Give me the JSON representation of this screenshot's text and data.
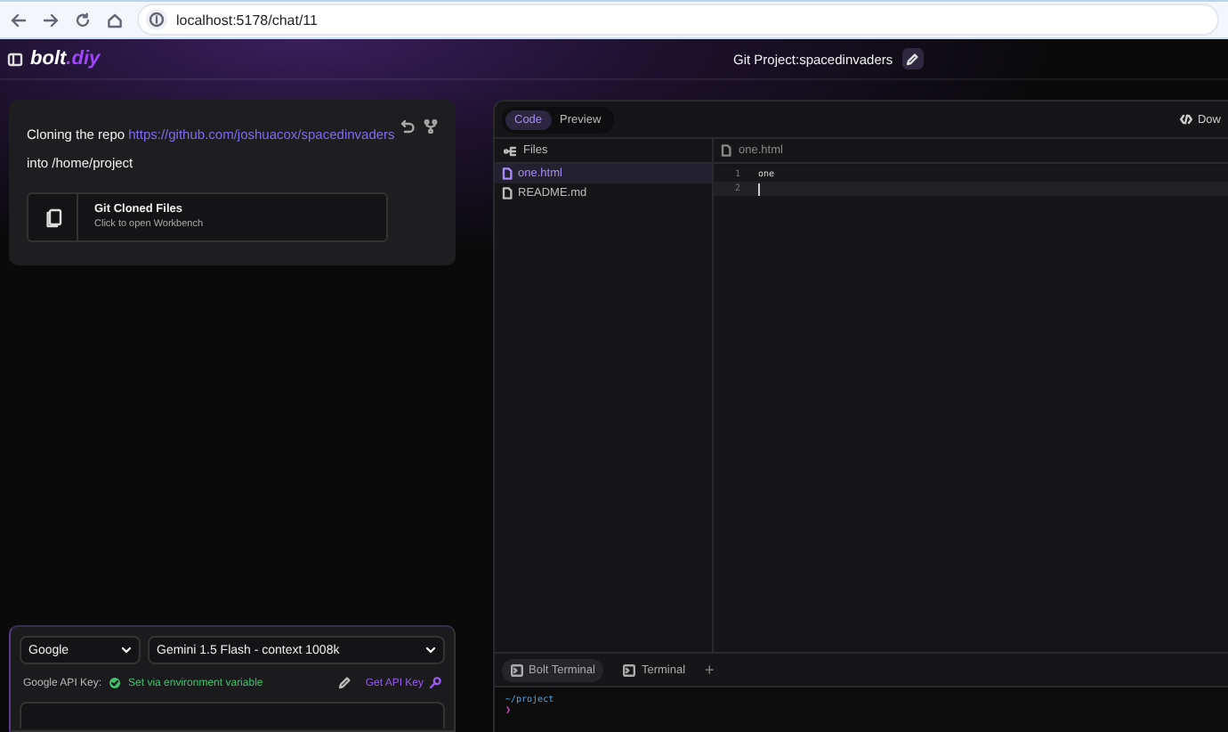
{
  "browser": {
    "url": "localhost:5178/chat/11"
  },
  "header": {
    "logo": {
      "text": "bolt",
      "accent": ".diy"
    },
    "project_title": "Git Project:spacedinvaders"
  },
  "chat": {
    "message": {
      "before": "Cloning the repo",
      "link": "https://github.com/joshuacox/spacedinvaders",
      "after": "into /home/project"
    },
    "artifact": {
      "title": "Git Cloned Files",
      "subtitle": "Click to open Workbench"
    }
  },
  "model_panel": {
    "provider": "Google",
    "model": "Gemini 1.5 Flash - context 1008k",
    "api_key_label": "Google API Key:",
    "api_key_status": "Set via environment variable",
    "get_key": "Get API Key"
  },
  "workbench": {
    "tabs": [
      {
        "label": "Code",
        "selected": true
      },
      {
        "label": "Preview",
        "selected": false
      }
    ],
    "download": "Dow",
    "files_header": "Files",
    "files": [
      {
        "name": "one.html",
        "selected": true
      },
      {
        "name": "README.md",
        "selected": false
      }
    ],
    "editor_tab": "one.html",
    "lines": [
      {
        "number": "1",
        "text": "one",
        "active": false
      },
      {
        "number": "2",
        "active": true
      }
    ],
    "terminal_tabs": [
      {
        "label": "Bolt Terminal",
        "selected": true
      },
      {
        "label": "Terminal",
        "selected": false
      }
    ],
    "add_terminal": "+",
    "terminal": {
      "path": "~/project",
      "prompt": "❯"
    }
  }
}
